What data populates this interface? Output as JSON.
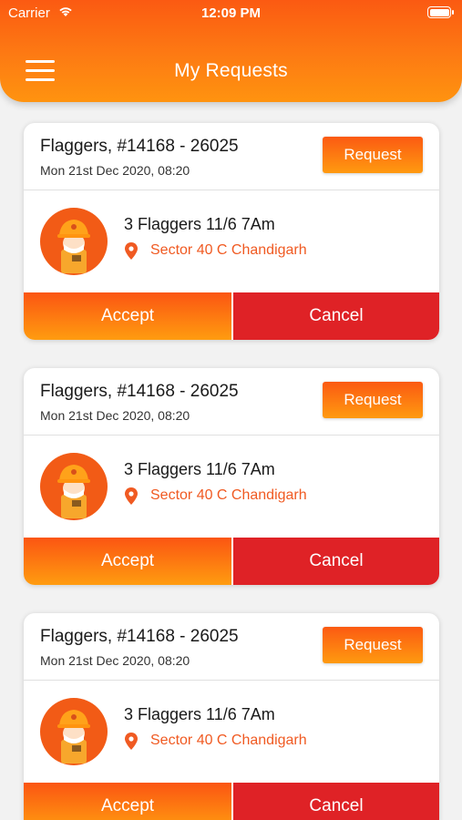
{
  "status_bar": {
    "carrier": "Carrier",
    "time": "12:09 PM"
  },
  "header": {
    "title": "My Requests",
    "menu_icon": "hamburger-menu-icon"
  },
  "colors": {
    "accent": "#fd7b13",
    "cancel": "#df2226",
    "location": "#f05a22"
  },
  "requests": [
    {
      "title": "Flaggers, #14168 - 26025",
      "date": "Mon 21st Dec 2020, 08:20",
      "request_label": "Request",
      "description": "3 Flaggers 11/6 7Am",
      "location": "Sector 40 C Chandigarh",
      "accept_label": "Accept",
      "cancel_label": "Cancel"
    },
    {
      "title": "Flaggers, #14168 - 26025",
      "date": "Mon 21st Dec 2020, 08:20",
      "request_label": "Request",
      "description": "3 Flaggers 11/6 7Am",
      "location": "Sector 40 C Chandigarh",
      "accept_label": "Accept",
      "cancel_label": "Cancel"
    },
    {
      "title": "Flaggers, #14168 - 26025",
      "date": "Mon 21st Dec 2020, 08:20",
      "request_label": "Request",
      "description": "3 Flaggers 11/6 7Am",
      "location": "Sector 40 C Chandigarh",
      "accept_label": "Accept",
      "cancel_label": "Cancel"
    }
  ]
}
